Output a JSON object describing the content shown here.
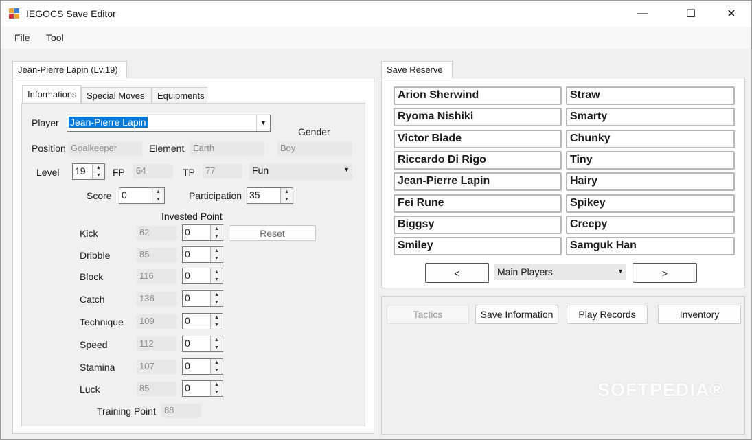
{
  "window": {
    "title": "IEGOCS Save Editor",
    "minimize": "—",
    "maximize": "☐",
    "close": "✕"
  },
  "menu": [
    "File",
    "Tool"
  ],
  "left_tab": "Jean-Pierre Lapin (Lv.19)",
  "subtabs": [
    "Informations",
    "Special Moves",
    "Equipments"
  ],
  "info": {
    "player_label": "Player",
    "player_value": "Jean-Pierre Lapin",
    "gender_label": "Gender",
    "gender_value": "Boy",
    "position_label": "Position",
    "position_value": "Goalkeeper",
    "element_label": "Element",
    "element_value": "Earth",
    "level_label": "Level",
    "level_value": "19",
    "fp_label": "FP",
    "fp_value": "64",
    "tp_label": "TP",
    "tp_value": "77",
    "mood_value": "Fun",
    "score_label": "Score",
    "score_value": "0",
    "participation_label": "Participation",
    "participation_value": "35",
    "invested_label": "Invested Point",
    "reset_label": "Reset",
    "training_label": "Training Point",
    "training_value": "88"
  },
  "stats": [
    {
      "name": "Kick",
      "value": "62",
      "invested": "0"
    },
    {
      "name": "Dribble",
      "value": "85",
      "invested": "0"
    },
    {
      "name": "Block",
      "value": "116",
      "invested": "0"
    },
    {
      "name": "Catch",
      "value": "136",
      "invested": "0"
    },
    {
      "name": "Technique",
      "value": "109",
      "invested": "0"
    },
    {
      "name": "Speed",
      "value": "112",
      "invested": "0"
    },
    {
      "name": "Stamina",
      "value": "107",
      "invested": "0"
    },
    {
      "name": "Luck",
      "value": "85",
      "invested": "0"
    }
  ],
  "reserve": {
    "tab": "Save Reserve",
    "left_column": [
      "Arion Sherwind",
      "Ryoma Nishiki",
      "Victor Blade",
      "Riccardo Di Rigo",
      "Jean-Pierre Lapin",
      "Fei Rune",
      "Biggsy",
      "Smiley"
    ],
    "right_column": [
      "Straw",
      "Smarty",
      "Chunky",
      "Tiny",
      "Hairy",
      "Spikey",
      "Creepy",
      "Samguk Han"
    ],
    "prev": "<",
    "next": ">",
    "group": "Main Players"
  },
  "actions": {
    "tactics": "Tactics",
    "save_info": "Save Information",
    "play_records": "Play Records",
    "inventory": "Inventory"
  },
  "watermark": "SOFTPEDIA®"
}
